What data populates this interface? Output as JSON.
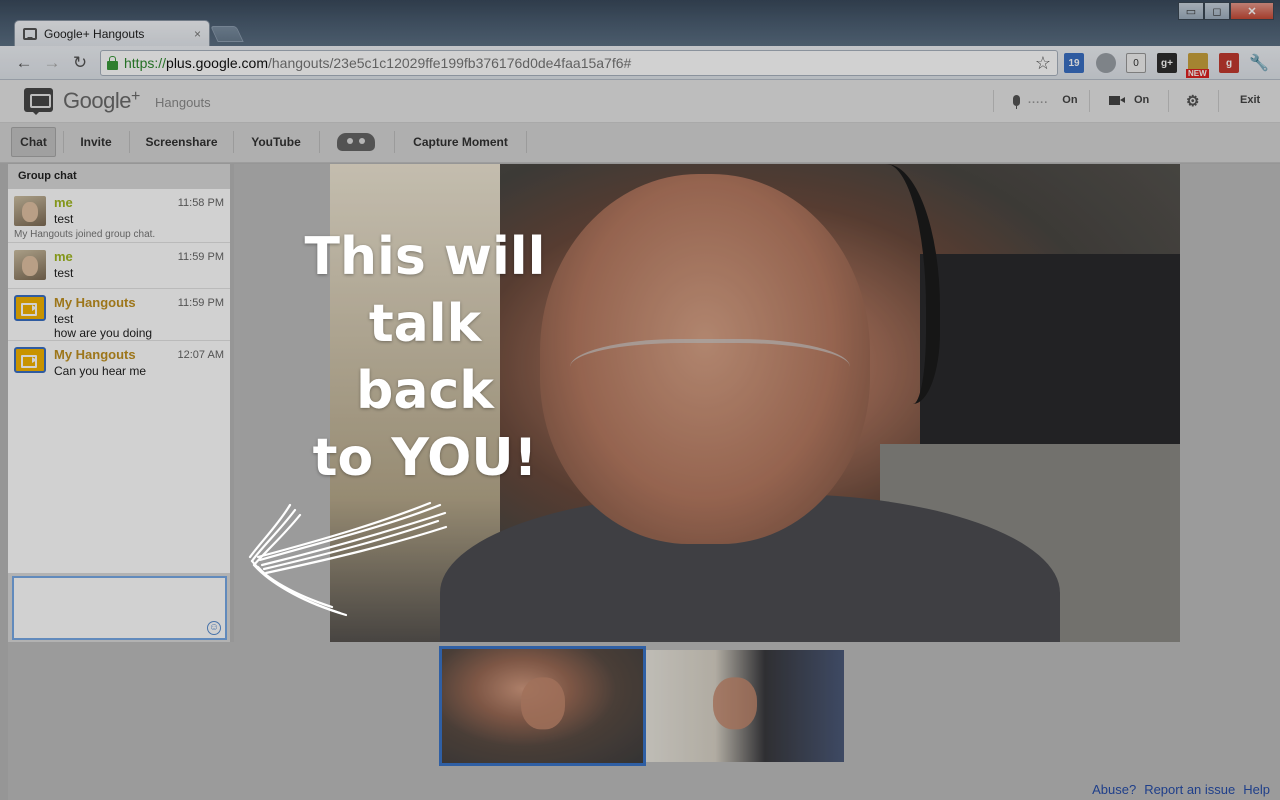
{
  "browser": {
    "tab_title": "Google+ Hangouts",
    "tab_close": "×",
    "url_scheme": "https://",
    "url_host": "plus.google.com",
    "url_path": "/hangouts/23e5c1c12029ffe199fb376176d0de4faa15a7f6#",
    "window_buttons": {
      "minimize": "▭",
      "maximize": "◻",
      "close": "✕"
    },
    "extensions": {
      "calendar": "19",
      "counter": "0",
      "gplus": "g+",
      "new_badge": "NEW",
      "gmail": "g"
    },
    "icons": [
      "back-icon",
      "forward-icon",
      "reload-icon",
      "lock-icon",
      "star-icon",
      "wrench-icon"
    ]
  },
  "header": {
    "brand": "Google",
    "brand_plus": "+",
    "product": "Hangouts",
    "mic_level": ".....",
    "mic_state": "On",
    "camera_state": "On",
    "exit": "Exit"
  },
  "toolbar": {
    "tabs": [
      "Chat",
      "Invite",
      "Screenshare",
      "YouTube"
    ],
    "capture": "Capture Moment"
  },
  "chat": {
    "title": "Group chat",
    "messages": [
      {
        "sender": "me",
        "time": "11:58 PM",
        "lines": [
          "test"
        ],
        "system": "My Hangouts joined group chat."
      },
      {
        "sender": "me",
        "time": "11:59 PM",
        "lines": [
          "test"
        ]
      },
      {
        "sender": "My Hangouts",
        "time": "11:59 PM",
        "lines": [
          "test",
          "how are you doing"
        ]
      },
      {
        "sender": "My Hangouts",
        "time": "12:07 AM",
        "lines": [
          "Can you hear me"
        ]
      }
    ],
    "input_value": ""
  },
  "callout": {
    "lines": [
      "This will",
      "talk",
      "back",
      "to YOU!"
    ]
  },
  "footer": {
    "abuse": "Abuse?",
    "report": "Report an issue",
    "help": "Help"
  },
  "colors": {
    "accent_blue": "#3a74c8",
    "sender_me": "#a0b820",
    "sender_bot": "#c09020",
    "link": "#1f3f8a"
  }
}
